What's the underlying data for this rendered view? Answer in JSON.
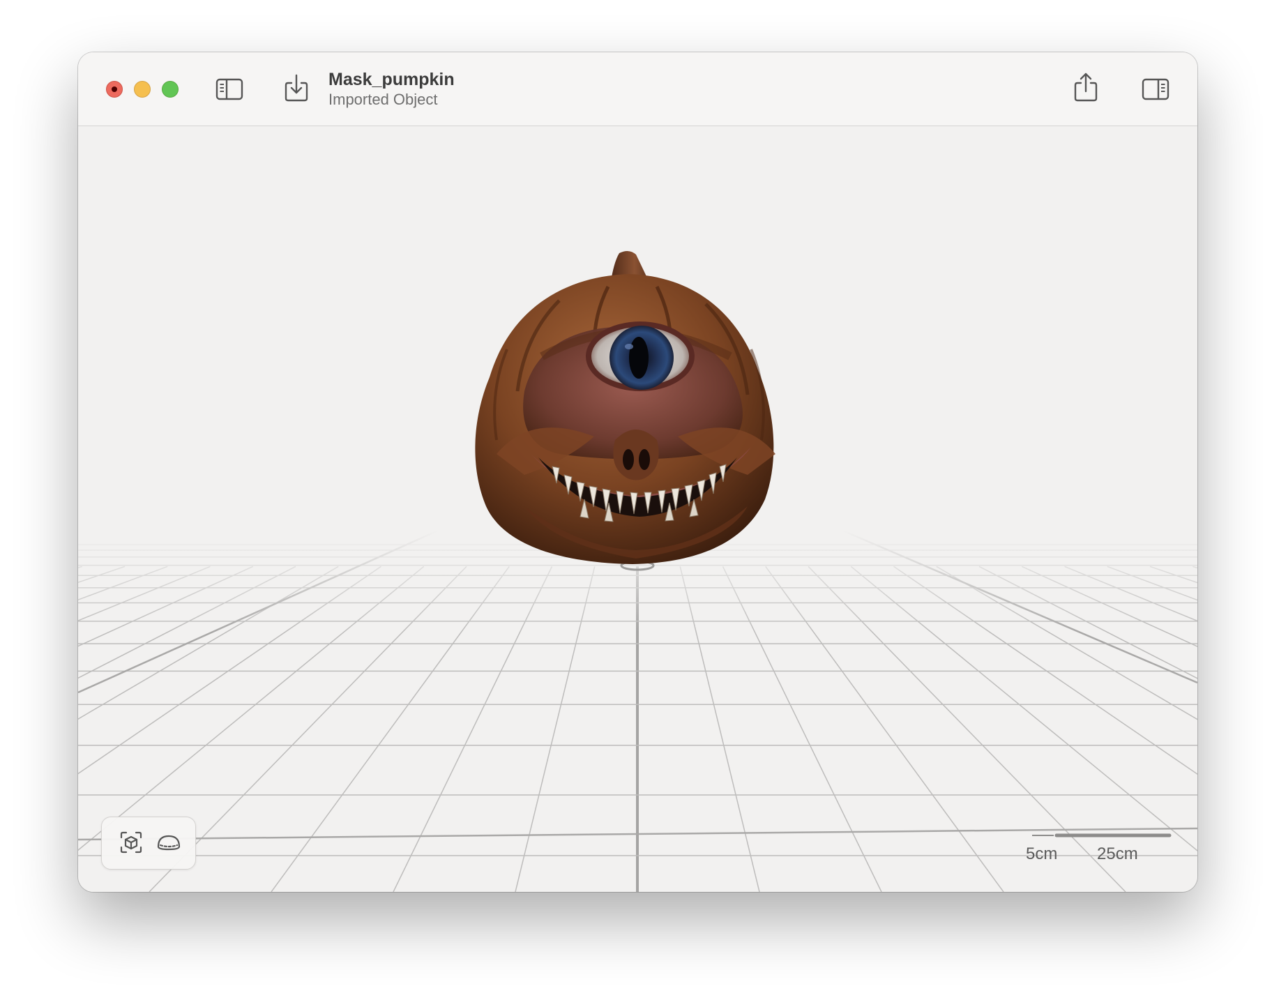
{
  "window": {
    "title": "Mask_pumpkin",
    "subtitle": "Imported Object"
  },
  "toolbar": {
    "left_icons": [
      "sidebar-icon",
      "import-icon"
    ],
    "right_icons": [
      "share-icon",
      "inspector-icon"
    ]
  },
  "viewport": {
    "model_name": "Mask_pumpkin",
    "scale": {
      "small_label": "5cm",
      "large_label": "25cm"
    },
    "controls": [
      "frame-object-icon",
      "ground-shadow-icon"
    ]
  },
  "colors": {
    "close": "#ed6a5e",
    "minimize": "#f5bf4f",
    "maximize": "#61c554",
    "window_bg": "#f2f1f0",
    "grid_line": "#b9b8b7"
  }
}
